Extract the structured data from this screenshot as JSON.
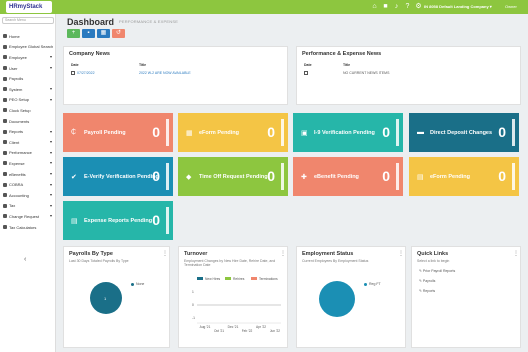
{
  "topbar": {
    "logo_text": "HRmyStack",
    "icons": [
      "home-icon",
      "briefcase-icon",
      "bell-icon",
      "help-icon",
      "settings-icon"
    ],
    "company": "IN 8058 Default Landing Company ▾",
    "profile": "Owner"
  },
  "sidebar": {
    "search_placeholder": "Search Menu",
    "items": [
      {
        "label": "Home",
        "caret": false
      },
      {
        "label": "Employee Global Search",
        "caret": false
      },
      {
        "label": "Employee",
        "caret": true
      },
      {
        "label": "User",
        "caret": true
      },
      {
        "label": "Payrolls",
        "caret": false
      },
      {
        "label": "System",
        "caret": true
      },
      {
        "label": "PEO Setup",
        "caret": true
      },
      {
        "label": "Clock Setup",
        "caret": false
      },
      {
        "label": "Documents",
        "caret": false
      },
      {
        "label": "Reports",
        "caret": true
      },
      {
        "label": "Client",
        "caret": true
      },
      {
        "label": "Performance",
        "caret": true
      },
      {
        "label": "Expense",
        "caret": true
      },
      {
        "label": "eBenefits",
        "caret": true
      },
      {
        "label": "COBRA",
        "caret": true
      },
      {
        "label": "Accounting",
        "caret": true
      },
      {
        "label": "Tax",
        "caret": true
      },
      {
        "label": "Change Request",
        "caret": true
      },
      {
        "label": "Tax Calculators",
        "caret": false
      }
    ],
    "collapse": "‹"
  },
  "header": {
    "title": "Dashboard",
    "subtitle": "PERFORMANCE & EXPENSE"
  },
  "company_news": {
    "title": "Company News",
    "col_date": "Date",
    "col_title": "Title",
    "row_date": "07/27/2022",
    "row_title": "2022 W-2 ARE NOW AVAILABLE"
  },
  "pe_news": {
    "title": "Performance & Expense News",
    "col_date": "Date",
    "col_title": "Title",
    "row_title": "NO CURRENT NEWS ITEMS"
  },
  "tiles": [
    {
      "label": "Payroll Pending",
      "count": "0",
      "color": "#f0866d",
      "icon": "₵"
    },
    {
      "label": "eForm Pending",
      "count": "0",
      "color": "#f4c545",
      "icon": "▦"
    },
    {
      "label": "I-9 Verification Pending",
      "count": "0",
      "color": "#26b6a9",
      "icon": "▣"
    },
    {
      "label": "Direct Deposit Changes",
      "count": "0",
      "color": "#1a6f88",
      "icon": "▬"
    },
    {
      "label": "E-Verify Verification Pending",
      "count": "0",
      "color": "#1b8fb4",
      "icon": "✔"
    },
    {
      "label": "Time Off Request Pending",
      "count": "0",
      "color": "#8dc63f",
      "icon": "◆"
    },
    {
      "label": "eBenefit Pending",
      "count": "0",
      "color": "#f0866d",
      "icon": "✚"
    },
    {
      "label": "eForm Pending",
      "count": "0",
      "color": "#f4c545",
      "icon": "▤"
    },
    {
      "label": "Expense Reports Pending",
      "count": "0",
      "color": "#26b6a9",
      "icon": "▤"
    }
  ],
  "payrolls_by_type": {
    "title": "Payrolls By Type",
    "subtitle": "Last 30 Days Totaled Payrolls By Type",
    "legend": "None",
    "pie_value": "1",
    "color": "#1a6f88"
  },
  "turnover": {
    "title": "Turnover",
    "subtitle": "Employment Changes by New Hire Date, Rehire Date, and Termination Date",
    "legend": [
      "New Hires",
      "Rehires",
      "Terminations"
    ],
    "legend_colors": [
      "#1a6f88",
      "#8dc63f",
      "#f0866d"
    ],
    "y_ticks": [
      "1",
      "0",
      "-1"
    ],
    "x_ticks": [
      "Aug '21",
      "Oct '21",
      "Dec '21",
      "Feb '22",
      "Apr '22",
      "Jun '22"
    ]
  },
  "employment_status": {
    "title": "Employment Status",
    "subtitle": "Current Employees By Employment Status",
    "legend": "Reg FT",
    "color": "#1b8fb4"
  },
  "quick_links": {
    "title": "Quick Links",
    "subtitle": "Select a link to begin",
    "links": [
      "Prior Payroll Reports",
      "Payrolls",
      "Reports"
    ]
  }
}
